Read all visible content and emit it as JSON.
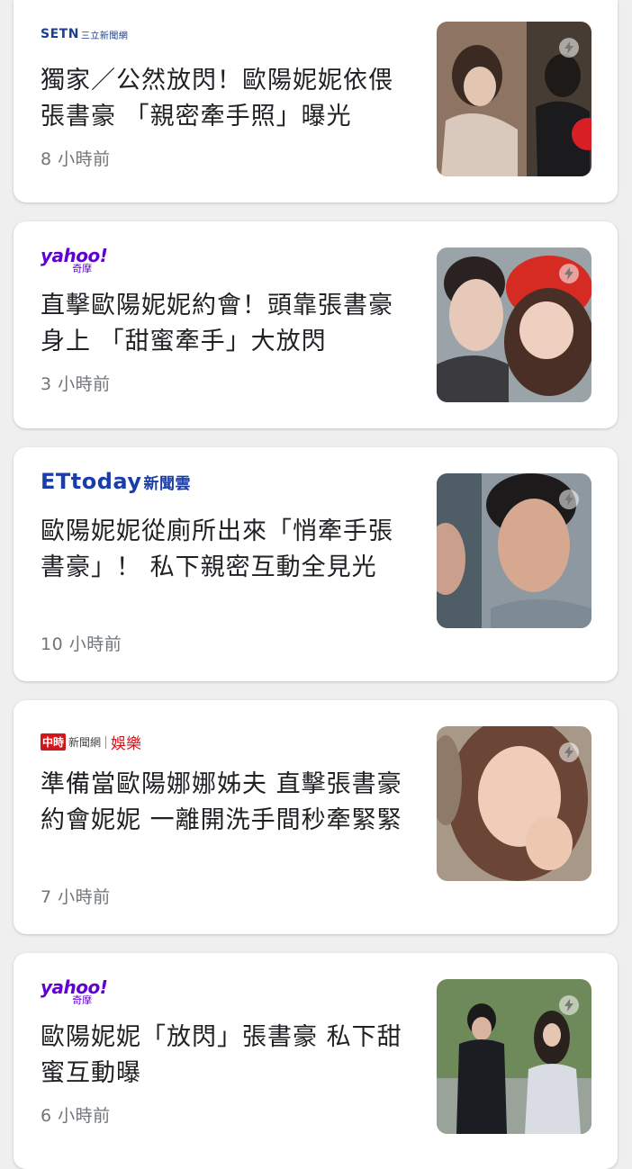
{
  "articles": [
    {
      "source": "SETN三立新聞網",
      "logo_main": "SETN",
      "logo_sub": "三立新聞網",
      "title": "獨家／公然放閃！歐陽妮妮依偎張書豪 「親密牽手照」曝光",
      "time": "8 小時前",
      "thumb_colors": [
        "#7a5a48",
        "#c9b7a8",
        "#2c2a28"
      ]
    },
    {
      "source": "yahoo!奇摩",
      "logo_main": "yahoo!",
      "logo_sub": "奇摩",
      "title": "直擊歐陽妮妮約會！頭靠張書豪身上 「甜蜜牽手」大放閃",
      "time": "3 小時前",
      "thumb_colors": [
        "#5b4a44",
        "#d93a2b",
        "#e8c4b4"
      ]
    },
    {
      "source": "ETtoday新聞雲",
      "logo_main": "ETtoday",
      "logo_sub": "新聞雲",
      "title": "歐陽妮妮從廁所出來「悄牽手張書豪」！ 私下親密互動全見光",
      "time": "10 小時前",
      "thumb_colors": [
        "#5d6b74",
        "#c59a84",
        "#8a97a2"
      ]
    },
    {
      "source": "中時新聞網 娛樂",
      "logo_main": "中時",
      "logo_sub": "新聞網",
      "logo_ent": "娛樂",
      "title": "準備當歐陽娜娜姊夫 直擊張書豪約會妮妮 一離開洗手間秒牽緊緊",
      "time": "7 小時前",
      "thumb_colors": [
        "#6b4a3a",
        "#e8c2ad",
        "#3f2e26"
      ]
    },
    {
      "source": "yahoo!奇摩",
      "logo_main": "yahoo!",
      "logo_sub": "奇摩",
      "title": "歐陽妮妮「放閃」張書豪 私下甜蜜互動曝",
      "time": "6 小時前",
      "thumb_colors": [
        "#5d7a4a",
        "#1f1f24",
        "#c9cfd6"
      ]
    }
  ]
}
